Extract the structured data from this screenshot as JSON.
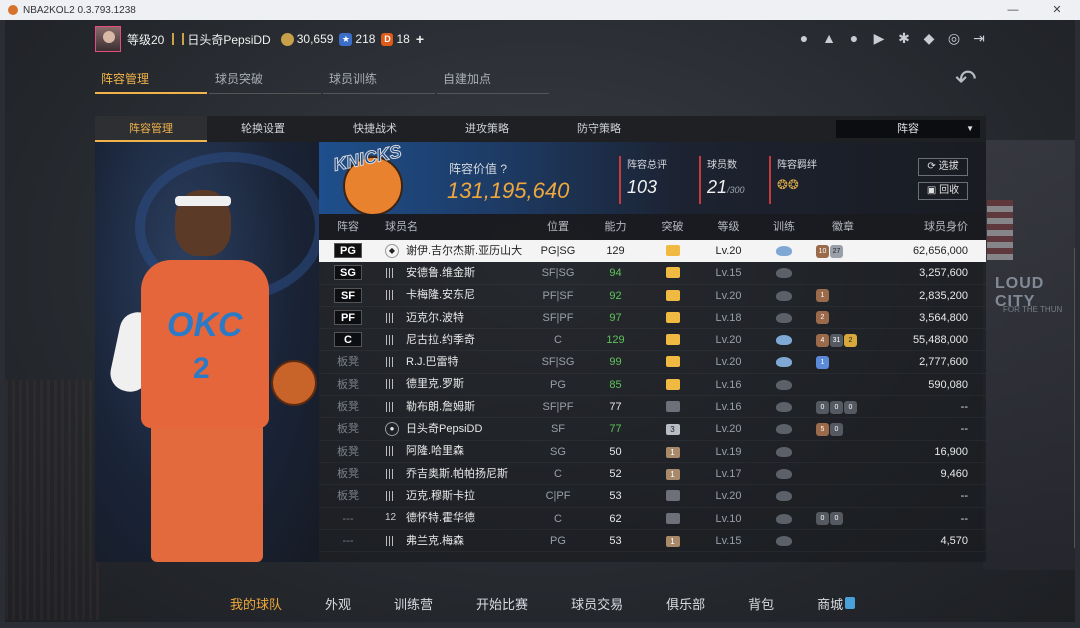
{
  "window": {
    "title": "NBA2KOL2 0.3.793.1238"
  },
  "user": {
    "level": "等级20",
    "name": "日头奇PepsiDD",
    "coins": "30,659",
    "stars": "218",
    "d_points": "18",
    "add": "+"
  },
  "main_tabs": [
    "阵容管理",
    "球员突破",
    "球员训练",
    "自建加点"
  ],
  "sub_tabs": [
    "阵容管理",
    "轮换设置",
    "快捷战术",
    "进攻策略",
    "防守策略"
  ],
  "lineup_select": "阵容",
  "team": {
    "logo_text": "KNICKS",
    "value_label": "阵容价值",
    "value": "131,195,640",
    "rating_label": "阵容总评",
    "rating": "103",
    "players_label": "球员数",
    "players": "21",
    "players_max": "/300",
    "bond_label": "阵容羁绊",
    "select_label": "选拔",
    "recycle_label": "回收"
  },
  "table_headers": {
    "slot": "阵容",
    "name": "球员名",
    "pos": "位置",
    "ability": "能力",
    "breakthrough": "突破",
    "level": "等级",
    "training": "训练",
    "badges": "徽章",
    "value": "球员身价"
  },
  "roster": [
    {
      "slot": "PG",
      "name": "谢伊.吉尔杰斯.亚历山大",
      "pos": "PG|SG",
      "ability": "129",
      "level": "Lv.20",
      "value": "62,656,000"
    },
    {
      "slot": "SG",
      "name": "安德鲁.维金斯",
      "pos": "SF|SG",
      "ability": "94",
      "level": "Lv.15",
      "value": "3,257,600"
    },
    {
      "slot": "SF",
      "name": "卡梅隆.安东尼",
      "pos": "PF|SF",
      "ability": "92",
      "level": "Lv.20",
      "value": "2,835,200"
    },
    {
      "slot": "PF",
      "name": "迈克尔.波特",
      "pos": "SF|PF",
      "ability": "97",
      "level": "Lv.18",
      "value": "3,564,800"
    },
    {
      "slot": "C",
      "name": "尼古拉.约季奇",
      "pos": "C",
      "ability": "129",
      "level": "Lv.20",
      "value": "55,488,000"
    },
    {
      "slot": "板凳",
      "name": "R.J.巴雷特",
      "pos": "SF|SG",
      "ability": "99",
      "level": "Lv.20",
      "value": "2,777,600"
    },
    {
      "slot": "板凳",
      "name": "德里克.罗斯",
      "pos": "PG",
      "ability": "85",
      "level": "Lv.16",
      "value": "590,080"
    },
    {
      "slot": "板凳",
      "name": "勒布朗.詹姆斯",
      "pos": "SF|PF",
      "ability": "77",
      "level": "Lv.16",
      "value": "--"
    },
    {
      "slot": "板凳",
      "name": "日头奇PepsiDD",
      "pos": "SF",
      "ability": "77",
      "level": "Lv.20",
      "value": "--"
    },
    {
      "slot": "板凳",
      "name": "阿隆.哈里森",
      "pos": "SG",
      "ability": "50",
      "level": "Lv.19",
      "value": "16,900"
    },
    {
      "slot": "板凳",
      "name": "乔吉奥斯.帕帕扬尼斯",
      "pos": "C",
      "ability": "52",
      "level": "Lv.17",
      "value": "9,460"
    },
    {
      "slot": "板凳",
      "name": "迈克.穆斯卡拉",
      "pos": "C|PF",
      "ability": "53",
      "level": "Lv.20",
      "value": "--"
    },
    {
      "slot": "---",
      "name": "德怀特.霍华德",
      "pos": "C",
      "ability": "62",
      "level": "Lv.10",
      "value": "--"
    },
    {
      "slot": "---",
      "name": "弗兰克.梅森",
      "pos": "PG",
      "ability": "53",
      "level": "Lv.15",
      "value": "4,570"
    }
  ],
  "bottom_nav": [
    "我的球队",
    "外观",
    "训练营",
    "开始比赛",
    "球员交易",
    "俱乐部",
    "背包",
    "商城"
  ],
  "art": {
    "jersey_text": "OKC",
    "jersey_number": "2",
    "arena_sign": "LOUD CITY",
    "arena_sign2": "FOR THE THUN"
  }
}
